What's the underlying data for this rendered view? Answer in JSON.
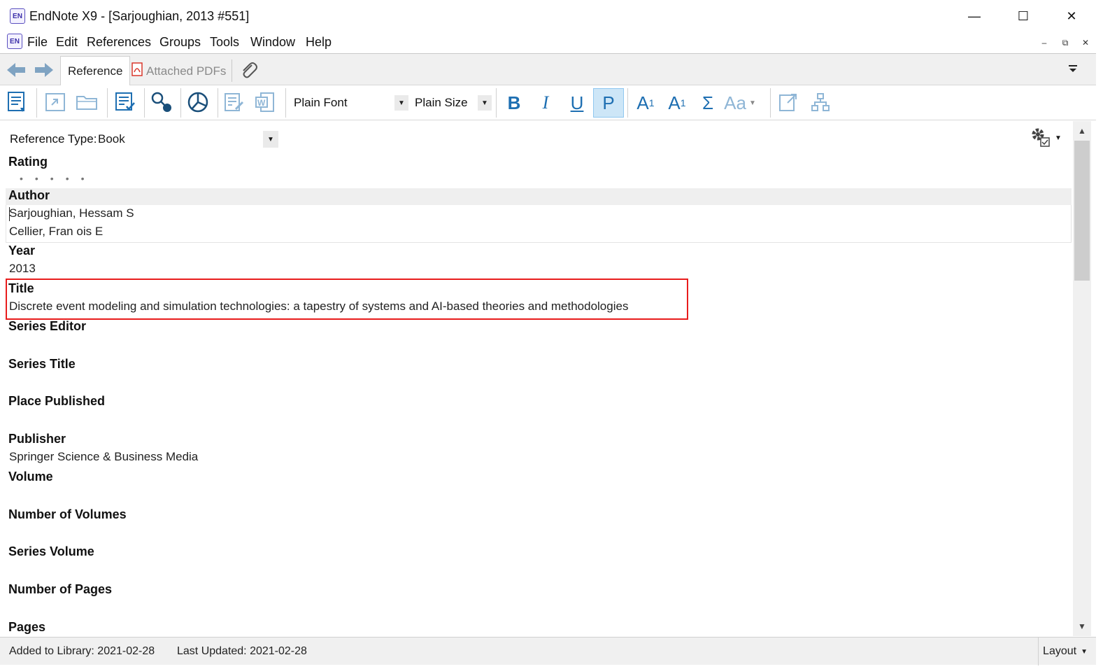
{
  "window": {
    "title": "EndNote X9 - [Sarjoughian, 2013 #551]",
    "logo_text": "EN",
    "controls": {
      "minimize": "—",
      "maximize": "☐",
      "close": "✕"
    }
  },
  "menu": {
    "items": [
      "File",
      "Edit",
      "References",
      "Groups",
      "Tools",
      "Window",
      "Help"
    ],
    "mdi_controls": {
      "minimize": "–",
      "restore": "⧉",
      "close": "✕"
    }
  },
  "tabs": {
    "reference": "Reference",
    "attached_pdfs": "Attached PDFs"
  },
  "toolbar": {
    "font": "Plain Font",
    "size": "Plain Size",
    "bold": "B",
    "italic": "I",
    "underline": "U",
    "plain": "P",
    "superscript": "A",
    "subscript": "A",
    "symbol": "Σ",
    "case": "Aa",
    "accent_color": "#1e6fb2"
  },
  "reference": {
    "type_label": "Reference Type:",
    "type_value": "Book",
    "fields": {
      "rating_label": "Rating",
      "rating_dots": "•••••",
      "author_label": "Author",
      "authors": [
        "Sarjoughian, Hessam S",
        "Cellier, Fran   ois E"
      ],
      "year_label": "Year",
      "year": "2013",
      "title_label": "Title",
      "title": "Discrete event modeling and simulation technologies: a tapestry of systems and AI-based theories and methodologies",
      "series_editor_label": "Series Editor",
      "series_title_label": "Series Title",
      "place_published_label": "Place Published",
      "publisher_label": "Publisher",
      "publisher": "Springer Science & Business Media",
      "volume_label": "Volume",
      "number_of_volumes_label": "Number of Volumes",
      "series_volume_label": "Series Volume",
      "number_of_pages_label": "Number of Pages",
      "pages_label": "Pages"
    },
    "highlight_color": "#e81c1c"
  },
  "status": {
    "added": "Added to Library: 2021-02-28",
    "updated": "Last Updated: 2021-02-28",
    "layout": "Layout"
  }
}
